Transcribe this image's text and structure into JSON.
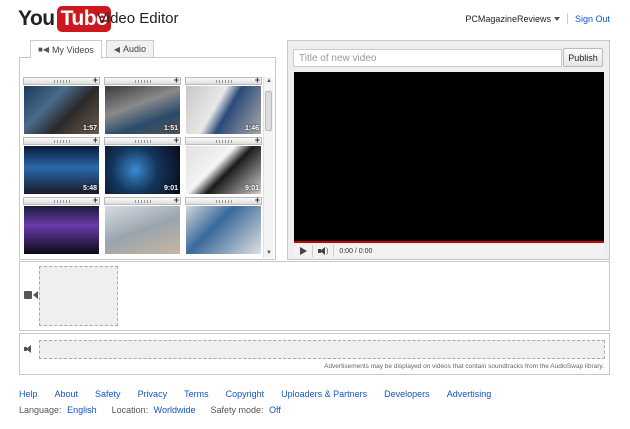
{
  "header": {
    "logo_you": "You",
    "logo_tube": "Tube",
    "title": "Video Editor",
    "username": "PCMagazineReviews",
    "signout": "Sign Out"
  },
  "tabs": [
    {
      "label": "My Videos",
      "icon": "video-camera-icon",
      "active": true
    },
    {
      "label": "Audio",
      "icon": "speaker-icon",
      "active": false
    }
  ],
  "videos": [
    {
      "duration": "1:57"
    },
    {
      "duration": "1:51"
    },
    {
      "duration": "1:46"
    },
    {
      "duration": "5:48"
    },
    {
      "duration": "9:01"
    },
    {
      "duration": "9:01"
    },
    {
      "duration": ""
    },
    {
      "duration": ""
    },
    {
      "duration": ""
    }
  ],
  "editor": {
    "title_placeholder": "Title of new video",
    "title_value": "",
    "publish_label": "Publish",
    "time_display": "0:00 / 0:00"
  },
  "timeline": {
    "audio_note": "Advertisements may be displayed on videos that contain soundtracks from the AudioSwap library."
  },
  "footer": {
    "links": [
      "Help",
      "About",
      "Safety",
      "Privacy",
      "Terms",
      "Copyright",
      "Uploaders & Partners",
      "Developers",
      "Advertising"
    ],
    "language_label": "Language:",
    "language_value": "English",
    "location_label": "Location:",
    "location_value": "Worldwide",
    "safety_label": "Safety mode:",
    "safety_value": "Off"
  },
  "colors": {
    "brand_red": "#cc181e",
    "link_blue": "#1155cc",
    "player_black": "#000000"
  }
}
